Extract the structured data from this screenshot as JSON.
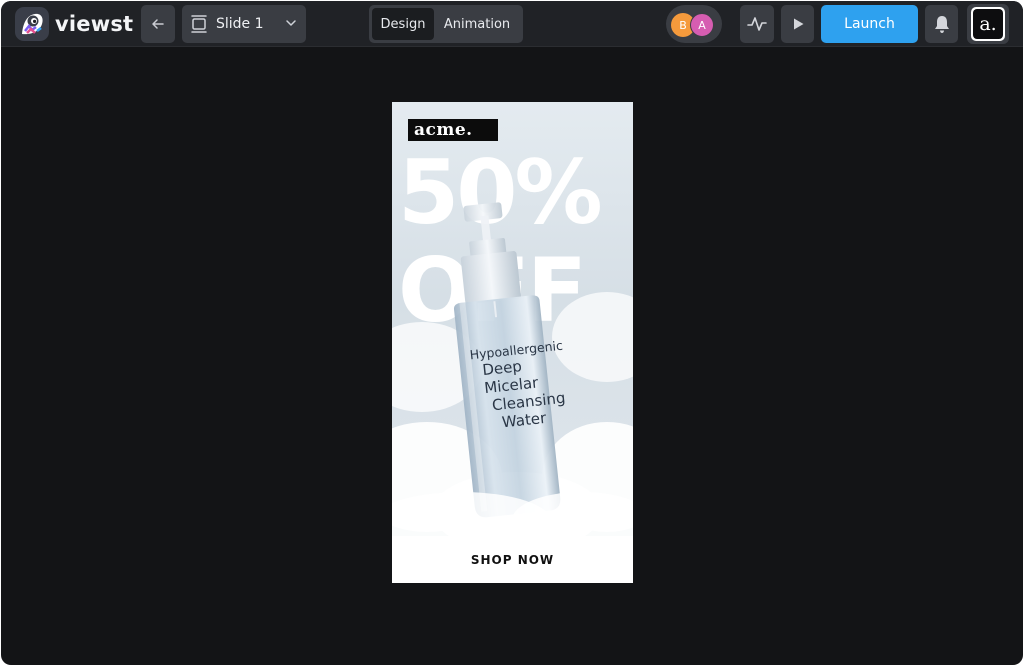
{
  "app": {
    "name": "viewst"
  },
  "toolbar": {
    "slide_label": "Slide 1",
    "mode_tabs": [
      "Design",
      "Animation"
    ],
    "active_mode": "Design",
    "collaborators": [
      "B",
      "A"
    ],
    "launch_label": "Launch",
    "account_initial": "a.",
    "colors": {
      "launch": "#2ea1ef",
      "avatar_b": "#f59a3c",
      "avatar_a": "#d65db1"
    }
  },
  "ad": {
    "brand": "acme.",
    "headline_lines": [
      "50%",
      "OFF"
    ],
    "bottle_label": {
      "line1": "Hypoallergenic",
      "line2": "Deep",
      "line3": "Micelar",
      "line4": "Cleansing",
      "line5": "Water"
    },
    "cta_label": "SHOP NOW"
  }
}
